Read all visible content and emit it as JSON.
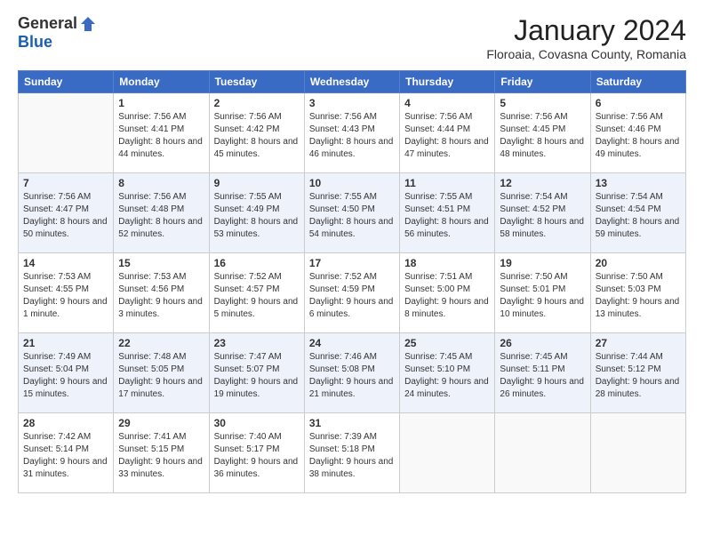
{
  "header": {
    "logo_general": "General",
    "logo_blue": "Blue",
    "title": "January 2024",
    "location": "Floroaia, Covasna County, Romania"
  },
  "days_of_week": [
    "Sunday",
    "Monday",
    "Tuesday",
    "Wednesday",
    "Thursday",
    "Friday",
    "Saturday"
  ],
  "weeks": [
    [
      {
        "day": "",
        "sunrise": "",
        "sunset": "",
        "daylight": ""
      },
      {
        "day": "1",
        "sunrise": "Sunrise: 7:56 AM",
        "sunset": "Sunset: 4:41 PM",
        "daylight": "Daylight: 8 hours and 44 minutes."
      },
      {
        "day": "2",
        "sunrise": "Sunrise: 7:56 AM",
        "sunset": "Sunset: 4:42 PM",
        "daylight": "Daylight: 8 hours and 45 minutes."
      },
      {
        "day": "3",
        "sunrise": "Sunrise: 7:56 AM",
        "sunset": "Sunset: 4:43 PM",
        "daylight": "Daylight: 8 hours and 46 minutes."
      },
      {
        "day": "4",
        "sunrise": "Sunrise: 7:56 AM",
        "sunset": "Sunset: 4:44 PM",
        "daylight": "Daylight: 8 hours and 47 minutes."
      },
      {
        "day": "5",
        "sunrise": "Sunrise: 7:56 AM",
        "sunset": "Sunset: 4:45 PM",
        "daylight": "Daylight: 8 hours and 48 minutes."
      },
      {
        "day": "6",
        "sunrise": "Sunrise: 7:56 AM",
        "sunset": "Sunset: 4:46 PM",
        "daylight": "Daylight: 8 hours and 49 minutes."
      }
    ],
    [
      {
        "day": "7",
        "sunrise": "Sunrise: 7:56 AM",
        "sunset": "Sunset: 4:47 PM",
        "daylight": "Daylight: 8 hours and 50 minutes."
      },
      {
        "day": "8",
        "sunrise": "Sunrise: 7:56 AM",
        "sunset": "Sunset: 4:48 PM",
        "daylight": "Daylight: 8 hours and 52 minutes."
      },
      {
        "day": "9",
        "sunrise": "Sunrise: 7:55 AM",
        "sunset": "Sunset: 4:49 PM",
        "daylight": "Daylight: 8 hours and 53 minutes."
      },
      {
        "day": "10",
        "sunrise": "Sunrise: 7:55 AM",
        "sunset": "Sunset: 4:50 PM",
        "daylight": "Daylight: 8 hours and 54 minutes."
      },
      {
        "day": "11",
        "sunrise": "Sunrise: 7:55 AM",
        "sunset": "Sunset: 4:51 PM",
        "daylight": "Daylight: 8 hours and 56 minutes."
      },
      {
        "day": "12",
        "sunrise": "Sunrise: 7:54 AM",
        "sunset": "Sunset: 4:52 PM",
        "daylight": "Daylight: 8 hours and 58 minutes."
      },
      {
        "day": "13",
        "sunrise": "Sunrise: 7:54 AM",
        "sunset": "Sunset: 4:54 PM",
        "daylight": "Daylight: 8 hours and 59 minutes."
      }
    ],
    [
      {
        "day": "14",
        "sunrise": "Sunrise: 7:53 AM",
        "sunset": "Sunset: 4:55 PM",
        "daylight": "Daylight: 9 hours and 1 minute."
      },
      {
        "day": "15",
        "sunrise": "Sunrise: 7:53 AM",
        "sunset": "Sunset: 4:56 PM",
        "daylight": "Daylight: 9 hours and 3 minutes."
      },
      {
        "day": "16",
        "sunrise": "Sunrise: 7:52 AM",
        "sunset": "Sunset: 4:57 PM",
        "daylight": "Daylight: 9 hours and 5 minutes."
      },
      {
        "day": "17",
        "sunrise": "Sunrise: 7:52 AM",
        "sunset": "Sunset: 4:59 PM",
        "daylight": "Daylight: 9 hours and 6 minutes."
      },
      {
        "day": "18",
        "sunrise": "Sunrise: 7:51 AM",
        "sunset": "Sunset: 5:00 PM",
        "daylight": "Daylight: 9 hours and 8 minutes."
      },
      {
        "day": "19",
        "sunrise": "Sunrise: 7:50 AM",
        "sunset": "Sunset: 5:01 PM",
        "daylight": "Daylight: 9 hours and 10 minutes."
      },
      {
        "day": "20",
        "sunrise": "Sunrise: 7:50 AM",
        "sunset": "Sunset: 5:03 PM",
        "daylight": "Daylight: 9 hours and 13 minutes."
      }
    ],
    [
      {
        "day": "21",
        "sunrise": "Sunrise: 7:49 AM",
        "sunset": "Sunset: 5:04 PM",
        "daylight": "Daylight: 9 hours and 15 minutes."
      },
      {
        "day": "22",
        "sunrise": "Sunrise: 7:48 AM",
        "sunset": "Sunset: 5:05 PM",
        "daylight": "Daylight: 9 hours and 17 minutes."
      },
      {
        "day": "23",
        "sunrise": "Sunrise: 7:47 AM",
        "sunset": "Sunset: 5:07 PM",
        "daylight": "Daylight: 9 hours and 19 minutes."
      },
      {
        "day": "24",
        "sunrise": "Sunrise: 7:46 AM",
        "sunset": "Sunset: 5:08 PM",
        "daylight": "Daylight: 9 hours and 21 minutes."
      },
      {
        "day": "25",
        "sunrise": "Sunrise: 7:45 AM",
        "sunset": "Sunset: 5:10 PM",
        "daylight": "Daylight: 9 hours and 24 minutes."
      },
      {
        "day": "26",
        "sunrise": "Sunrise: 7:45 AM",
        "sunset": "Sunset: 5:11 PM",
        "daylight": "Daylight: 9 hours and 26 minutes."
      },
      {
        "day": "27",
        "sunrise": "Sunrise: 7:44 AM",
        "sunset": "Sunset: 5:12 PM",
        "daylight": "Daylight: 9 hours and 28 minutes."
      }
    ],
    [
      {
        "day": "28",
        "sunrise": "Sunrise: 7:42 AM",
        "sunset": "Sunset: 5:14 PM",
        "daylight": "Daylight: 9 hours and 31 minutes."
      },
      {
        "day": "29",
        "sunrise": "Sunrise: 7:41 AM",
        "sunset": "Sunset: 5:15 PM",
        "daylight": "Daylight: 9 hours and 33 minutes."
      },
      {
        "day": "30",
        "sunrise": "Sunrise: 7:40 AM",
        "sunset": "Sunset: 5:17 PM",
        "daylight": "Daylight: 9 hours and 36 minutes."
      },
      {
        "day": "31",
        "sunrise": "Sunrise: 7:39 AM",
        "sunset": "Sunset: 5:18 PM",
        "daylight": "Daylight: 9 hours and 38 minutes."
      },
      {
        "day": "",
        "sunrise": "",
        "sunset": "",
        "daylight": ""
      },
      {
        "day": "",
        "sunrise": "",
        "sunset": "",
        "daylight": ""
      },
      {
        "day": "",
        "sunrise": "",
        "sunset": "",
        "daylight": ""
      }
    ]
  ]
}
